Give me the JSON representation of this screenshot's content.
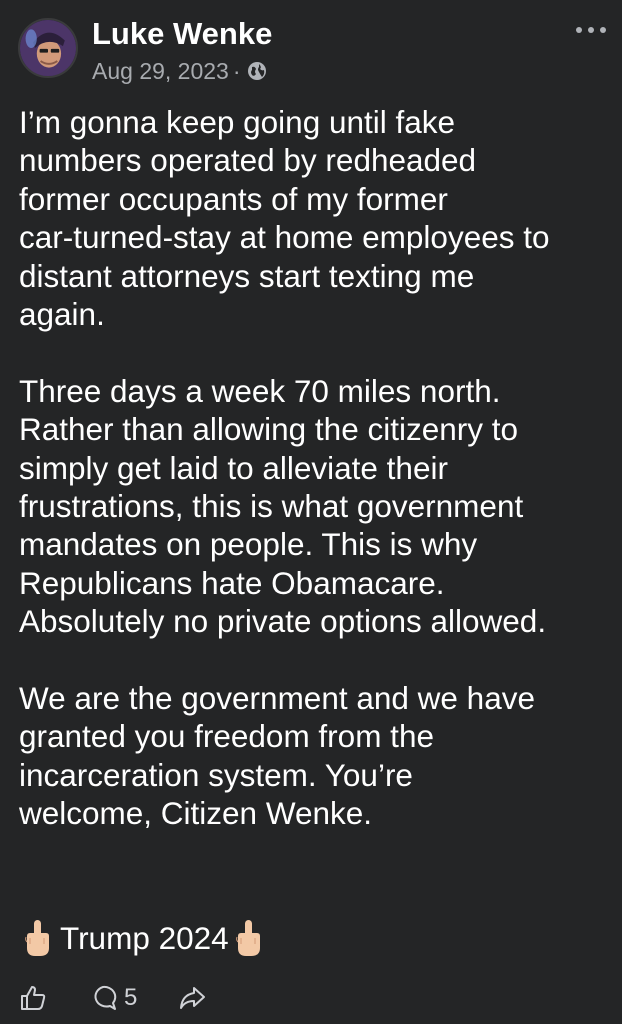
{
  "post": {
    "author": "Luke Wenke",
    "date": "Aug 29, 2023",
    "separator": "·",
    "privacy_icon": "globe-icon",
    "more_icon": "more-dots-icon",
    "paragraphs": [
      [
        "I’m gonna keep going until fake",
        "numbers operated by redheaded",
        "former occupants of my former",
        "car-turned-stay at home employees to",
        "distant attorneys start texting me",
        "again."
      ],
      [
        "Three days a week 70 miles north.",
        "Rather than allowing the citizenry to",
        "simply get laid to alleviate their",
        "frustrations, this is what government",
        "mandates on people.  This is why",
        "Republicans hate Obamacare.",
        "Absolutely no private options allowed."
      ],
      [
        "We are the government and we have",
        "granted you freedom from the",
        "incarceration system.  You’re",
        "welcome, Citizen Wenke."
      ]
    ],
    "sign_off": "Trump 2024",
    "sign_off_icon": "middle-finger-emoji-icon"
  },
  "actions": {
    "like_icon": "like-icon",
    "comment_icon": "comment-icon",
    "comment_count": "5",
    "share_icon": "share-icon"
  },
  "colors": {
    "background": "#242526",
    "text": "#ffffff",
    "secondary": "#a8abaf"
  }
}
